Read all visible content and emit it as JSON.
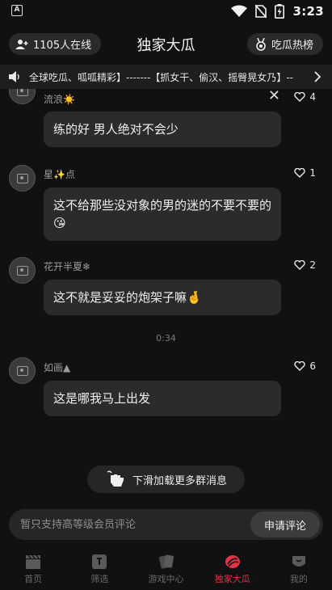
{
  "status_bar": {
    "app_badge": "A",
    "time": "3:23",
    "icons": [
      "wifi-icon",
      "no-sim-icon",
      "battery-charging-icon"
    ]
  },
  "header": {
    "online_count_text": "1105人在线",
    "title": "独家大瓜",
    "hot_list_label": "吃瓜热榜"
  },
  "marquee": {
    "text": "全球吃瓜、呱呱精彩】-------【抓女干、偷汉、摇臀晃女乃】--"
  },
  "messages": [
    {
      "username": "流浪☀️",
      "likes": "4",
      "text": "练的好 男人绝对不会少"
    },
    {
      "username": "星✨点",
      "likes": "1",
      "text": "这不给那些没对象的男的迷的不要不要的😘"
    },
    {
      "username": "花开半夏❄",
      "likes": "2",
      "text": "这不就是妥妥的炮架子嘛🤞"
    },
    {
      "username": "如画▲",
      "likes": "6",
      "text": "这是哪我马上出发"
    }
  ],
  "timestamp": "0:34",
  "load_more_label": "下滑加载更多群消息",
  "comment": {
    "placeholder": "暂只支持高等级会员评论",
    "apply_label": "申请评论"
  },
  "nav": [
    {
      "label": "首页",
      "icon": "clapperboard-icon",
      "active": false
    },
    {
      "label": "筛选",
      "icon": "filter-icon",
      "active": false
    },
    {
      "label": "游戏中心",
      "icon": "cards-icon",
      "active": false
    },
    {
      "label": "独家大瓜",
      "icon": "melon-icon",
      "active": true
    },
    {
      "label": "我的",
      "icon": "profile-icon",
      "active": false
    }
  ],
  "colors": {
    "background": "#111111",
    "bubble": "#2b2b2b",
    "accent": "#e0344a"
  }
}
